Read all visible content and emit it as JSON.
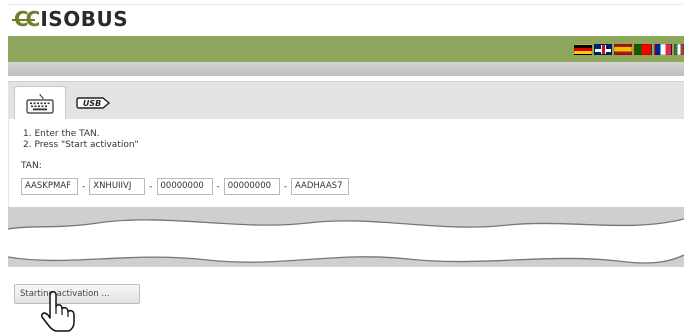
{
  "header": {
    "logo_prefix": "CC",
    "logo_word": "ISOBUS"
  },
  "language_flags": [
    "flag-de-icon",
    "flag-gb-icon",
    "flag-es-icon",
    "flag-pt-icon",
    "flag-fr-icon",
    "flag-it-icon"
  ],
  "tabs": [
    {
      "name": "tab-keyboard",
      "icon": "keyboard-icon",
      "active": true
    },
    {
      "name": "tab-usb",
      "icon": "usb-icon",
      "label": "USB",
      "active": false
    }
  ],
  "instructions": {
    "step1": "1. Enter the TAN.",
    "step2": "2. Press \"Start activation\""
  },
  "tan": {
    "label": "TAN:",
    "fields": [
      "AASKPMAF",
      "XNHUIIVJ",
      "00000000",
      "00000000",
      "AADHAAS7"
    ],
    "separator": "-"
  },
  "actions": {
    "start_label": "Starting activation ..."
  },
  "colors": {
    "header_green": "#8ea55c",
    "logo_green": "#6d7f2c"
  }
}
